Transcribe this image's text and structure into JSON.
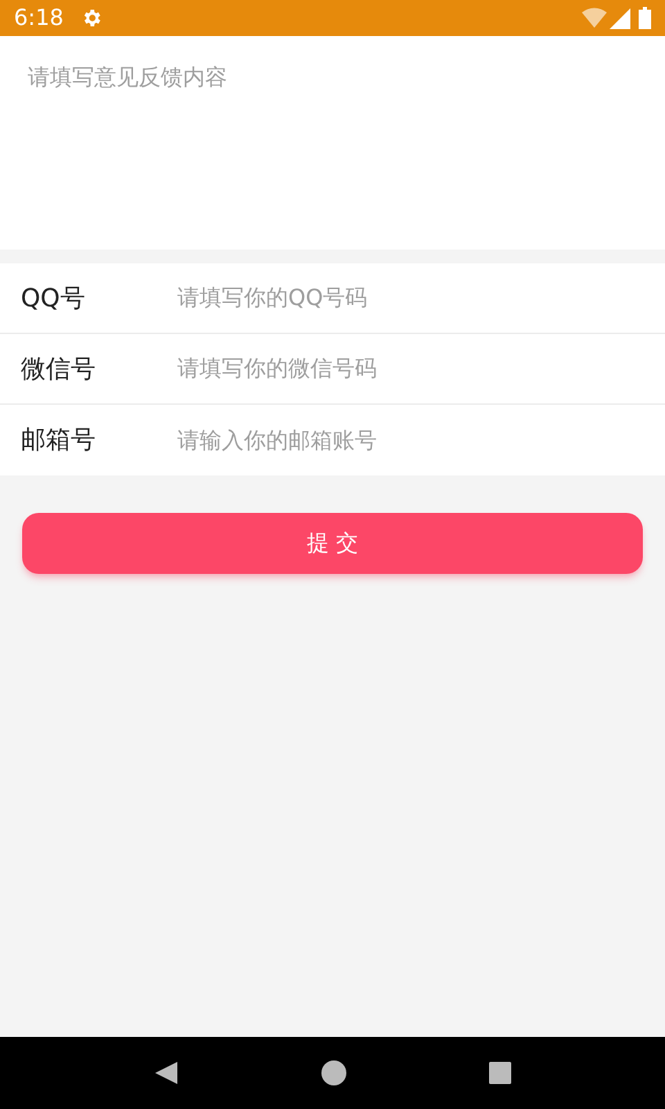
{
  "status_bar": {
    "time": "6:18"
  },
  "feedback": {
    "placeholder": "请填写意见反馈内容"
  },
  "fields": [
    {
      "label": "QQ号",
      "placeholder": "请填写你的QQ号码"
    },
    {
      "label": "微信号",
      "placeholder": "请填写你的微信号码"
    },
    {
      "label": "邮箱号",
      "placeholder": "请输入你的邮箱账号"
    }
  ],
  "submit_button": {
    "label": "提 交"
  }
}
